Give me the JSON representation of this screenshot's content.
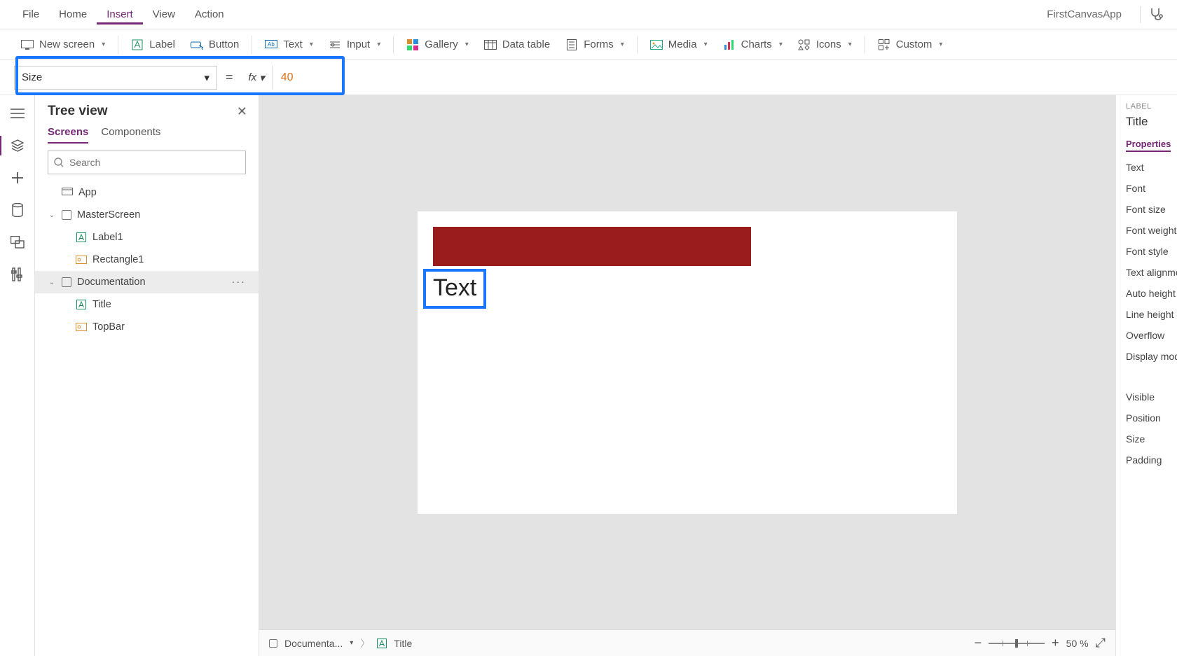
{
  "menu": {
    "items": [
      "File",
      "Home",
      "Insert",
      "View",
      "Action"
    ],
    "active_index": 2,
    "app_name": "FirstCanvasApp"
  },
  "ribbon": {
    "new_screen": "New screen",
    "label": "Label",
    "button": "Button",
    "text": "Text",
    "input": "Input",
    "gallery": "Gallery",
    "data_table": "Data table",
    "forms": "Forms",
    "media": "Media",
    "charts": "Charts",
    "icons": "Icons",
    "custom": "Custom"
  },
  "formula": {
    "property_name": "Size",
    "value": "40"
  },
  "tree": {
    "title": "Tree view",
    "tabs": [
      "Screens",
      "Components"
    ],
    "active_tab": 0,
    "search_placeholder": "Search",
    "app_label": "App",
    "nodes": {
      "master": {
        "name": "MasterScreen",
        "children": [
          "Label1",
          "Rectangle1"
        ]
      },
      "doc": {
        "name": "Documentation",
        "children": [
          "Title",
          "TopBar"
        ]
      }
    },
    "selected": "Documentation"
  },
  "canvas": {
    "title_text": "Text"
  },
  "breadcrumb": {
    "screen": "Documenta...",
    "control": "Title",
    "zoom_label": "50  %"
  },
  "props": {
    "kind": "LABEL",
    "name": "Title",
    "tab": "Properties",
    "rows": [
      "Text",
      "Font",
      "Font size",
      "Font weight",
      "Font style",
      "Text alignme",
      "Auto height",
      "Line height",
      "Overflow",
      "Display mod"
    ],
    "rows2": [
      "Visible",
      "Position",
      "Size",
      "Padding"
    ]
  }
}
